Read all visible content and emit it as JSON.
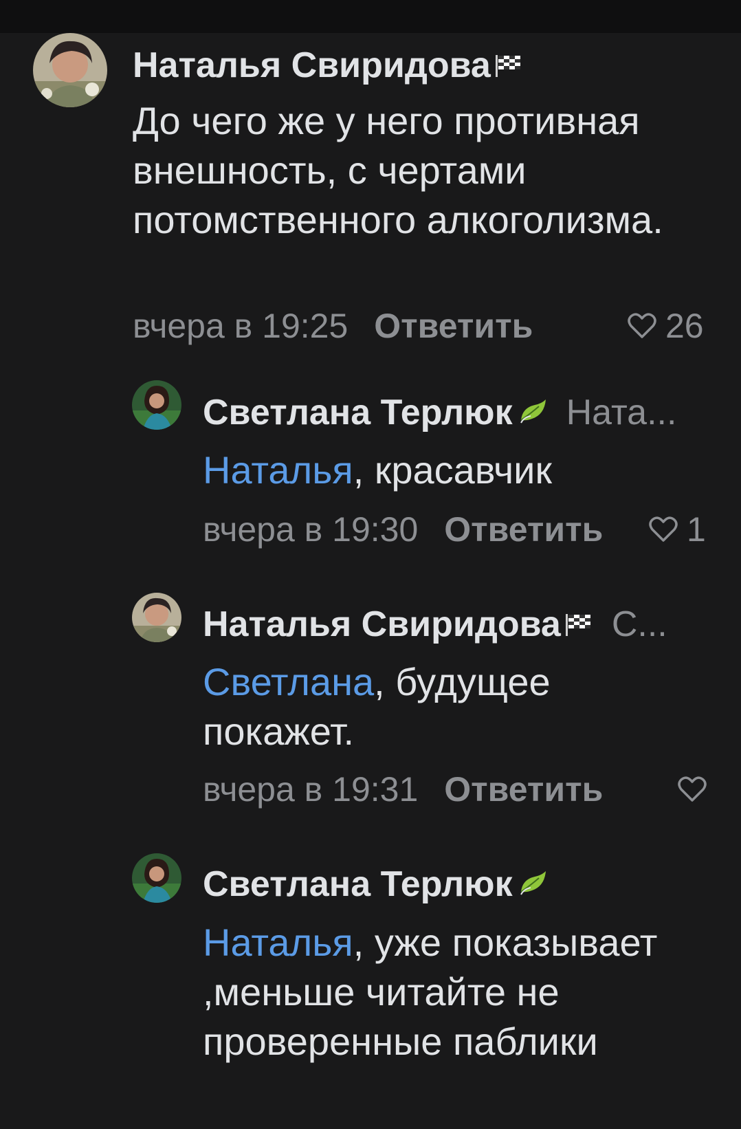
{
  "comments": [
    {
      "author": "Наталья Свиридова",
      "text": "До чего же у него противная внешность, с чертами потомственного алкоголизма.",
      "time": "вчера в 19:25",
      "reply_label": "Ответить",
      "likes": "26"
    }
  ],
  "replies": [
    {
      "author": "Светлана Терлюк",
      "reply_to": "Ната...",
      "mention": "Наталья",
      "text": ", красавчик",
      "time": "вчера в 19:30",
      "reply_label": "Ответить",
      "likes": "1"
    },
    {
      "author": "Наталья Свиридова",
      "reply_to": "С...",
      "mention": "Светлана",
      "text": ", будущее покажет.",
      "time": "вчера в 19:31",
      "reply_label": "Ответить",
      "likes": ""
    },
    {
      "author": "Светлана Терлюк",
      "reply_to": "",
      "mention": "Наталья",
      "text": ", уже показывает ,меньше читайте не проверенные паблики",
      "time": "",
      "reply_label": "",
      "likes": ""
    }
  ],
  "icons": {
    "flag_badge": "checkered-flag-icon",
    "leaf_badge": "leaf-icon",
    "like": "heart-outline-icon"
  },
  "colors": {
    "background": "#19191a",
    "text": "#e1e3e6",
    "secondary": "#8d8f93",
    "mention": "#5b9be6"
  }
}
